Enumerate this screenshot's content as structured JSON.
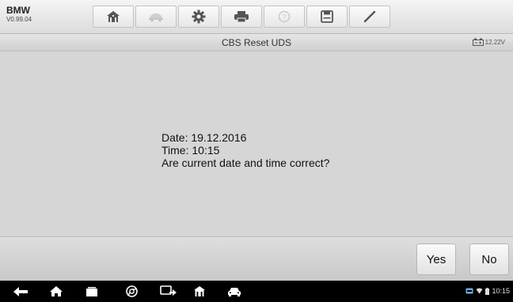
{
  "header": {
    "make": "BMW",
    "version": "V0.99.04",
    "tools": [
      {
        "name": "home-icon"
      },
      {
        "name": "vehicle-swap-icon"
      },
      {
        "name": "settings-icon"
      },
      {
        "name": "print-icon"
      },
      {
        "name": "help-icon"
      },
      {
        "name": "save-icon"
      },
      {
        "name": "edit-icon"
      }
    ]
  },
  "titlebar": {
    "title": "CBS Reset UDS",
    "battery_voltage": "12.22V"
  },
  "message": {
    "date_line": "Date: 19.12.2016",
    "time_line": "Time: 10:15",
    "question": "Are current date and time correct?"
  },
  "buttons": {
    "yes": "Yes",
    "no": "No"
  },
  "navbar": {
    "icons": [
      "back-icon",
      "home-icon",
      "recent-apps-icon",
      "chrome-icon",
      "vci-icon",
      "maxisys-home-icon",
      "car-icon"
    ],
    "clock": "10:15"
  },
  "colors": {
    "background": "#d6d6d6",
    "toolbar": "#e8e8e8",
    "navbar": "#000000"
  }
}
